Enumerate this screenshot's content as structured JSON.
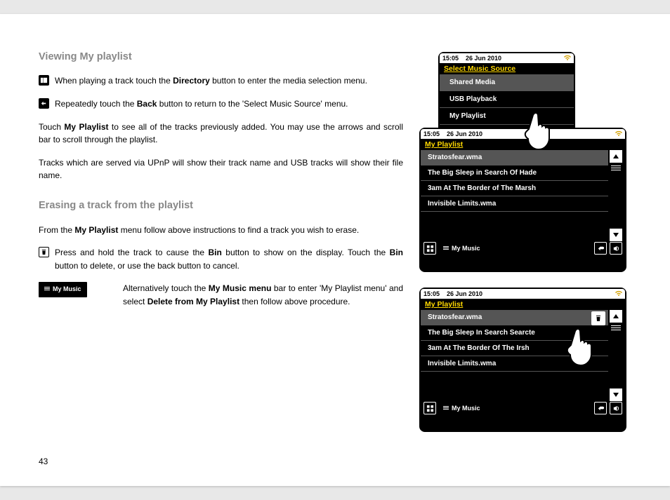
{
  "page_number": "43",
  "sections": {
    "viewing_title": "Viewing My playlist",
    "erasing_title": "Erasing a track from the playlist"
  },
  "paragraphs": {
    "p1_pre": "When playing a track touch the ",
    "p1_bold": "Directory",
    "p1_post": " button to enter the media selection menu.",
    "p2_pre": "Repeatedly touch the ",
    "p2_bold": "Back",
    "p2_post": " button to return to the 'Select Music Source' menu.",
    "p3_pre": "Touch ",
    "p3_bold": "My Playlist",
    "p3_post": " to see all of the tracks previously added. You may use the arrows and scroll bar to scroll through the playlist.",
    "p4": "Tracks which are served via UPnP will show their track name and USB tracks will show their file name.",
    "p5_pre": "From the ",
    "p5_bold": "My Playlist",
    "p5_post": " menu follow above instructions to find a track you wish to erase.",
    "p6_pre": "Press and hold the track to cause the ",
    "p6_bold1": "Bin",
    "p6_mid": " button to show on the display. Touch the ",
    "p6_bold2": "Bin",
    "p6_post": " button to delete, or use the back button to cancel.",
    "p7_pre": "Alternatively touch the ",
    "p7_bold1": "My Music menu",
    "p7_mid": " bar to enter 'My Playlist menu' and select ",
    "p7_bold2": "Delete from My Playlist",
    "p7_post": " then follow above procedure."
  },
  "chip_label": "My Music",
  "status": {
    "time": "15:05",
    "date": "26 Jun 2010"
  },
  "device1": {
    "title": "Select Music Source",
    "items": [
      "Shared Media",
      "USB Playback",
      "My Playlist"
    ]
  },
  "device2": {
    "title": "My Playlist",
    "items": [
      "Stratosfear.wma",
      "The Big Sleep in Search Of Hade",
      "3am At The Border of The Marsh",
      "Invisible Limits.wma"
    ],
    "bottom": "My Music"
  },
  "device3": {
    "title": "My Playlist",
    "items": [
      "Stratosfear.wma",
      "The Big Sleep In Search Searcte",
      "3am At The Border Of The Irsh",
      "Invisible Limits.wma"
    ],
    "bottom": "My Music"
  }
}
